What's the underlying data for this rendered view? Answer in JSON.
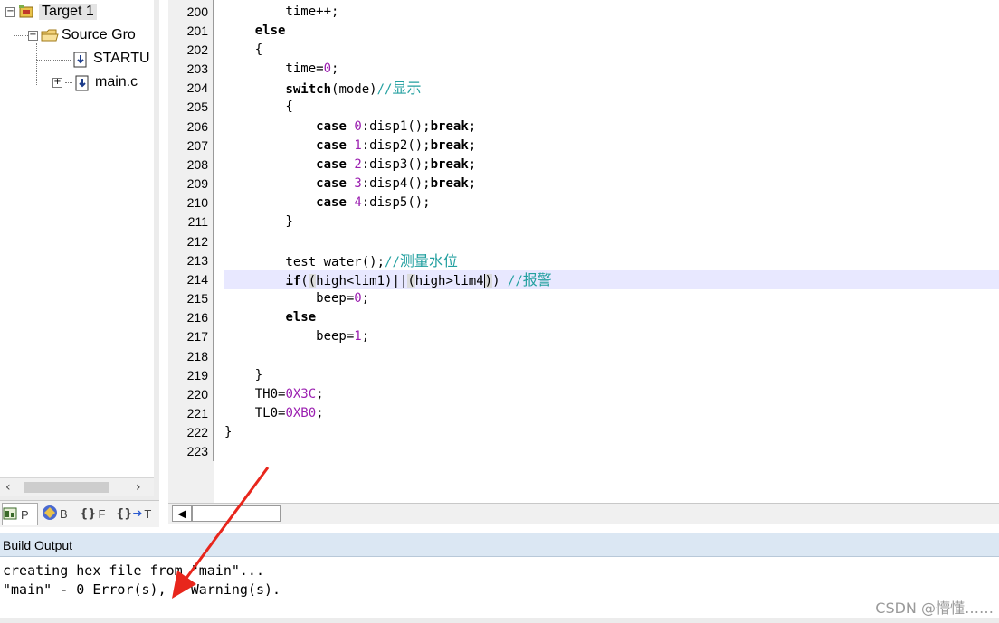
{
  "project_tree": {
    "target": "Target 1",
    "group": "Source Gro",
    "files": [
      "STARTU",
      "main.c"
    ]
  },
  "panel_tabs": [
    "P",
    "B",
    "F",
    "T"
  ],
  "editor": {
    "line_numbers": [
      "200",
      "201",
      "202",
      "203",
      "204",
      "205",
      "206",
      "207",
      "208",
      "209",
      "210",
      "211",
      "212",
      "213",
      "214",
      "215",
      "216",
      "217",
      "218",
      "219",
      "220",
      "221",
      "222",
      "223"
    ],
    "highlighted_line": "214"
  },
  "build_output": {
    "title": "Build Output",
    "lines": [
      "creating hex file from \"main\"...",
      "\"main\" - 0 Error(s), 0 Warning(s)."
    ]
  },
  "watermark": "CSDN @懵懂……",
  "colors": {
    "keyword": "#000000",
    "number": "#9b1fb0",
    "comment": "#23a0a0",
    "current_line": "#e8e8ff",
    "build_title_bg": "#dbe7f3",
    "arrow": "#e8261c"
  },
  "icons": {
    "target": "target-icon",
    "group": "folder-icon",
    "file": "c-file-icon",
    "annotation": "red-arrow"
  }
}
